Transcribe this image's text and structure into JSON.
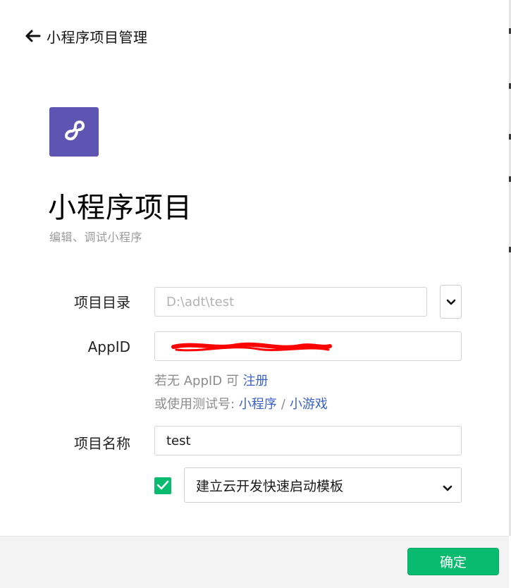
{
  "header": {
    "title": "小程序项目管理"
  },
  "page": {
    "title": "小程序项目",
    "subtitle": "编辑、调试小程序"
  },
  "form": {
    "directory": {
      "label": "项目目录",
      "value": "D:\\adt\\test"
    },
    "appid": {
      "label": "AppID",
      "hint_prefix": "若无 AppID 可",
      "register_link": "注册",
      "test_prefix": "或使用测试号:",
      "miniprogram_link": "小程序",
      "separator": "/",
      "minigame_link": "小游戏"
    },
    "name": {
      "label": "项目名称",
      "value": "test"
    },
    "template": {
      "checked": true,
      "selected": "建立云开发快速启动模板"
    }
  },
  "footer": {
    "confirm_label": "确定"
  },
  "colors": {
    "brand": "#5d55b1",
    "accent": "#09bb6f",
    "link": "#3b62c4",
    "redaction": "#ff0000"
  },
  "icons": {
    "back": "arrow-left-icon",
    "logo": "miniprogram-logo-icon",
    "chevron": "chevron-down-icon",
    "check": "check-icon"
  }
}
